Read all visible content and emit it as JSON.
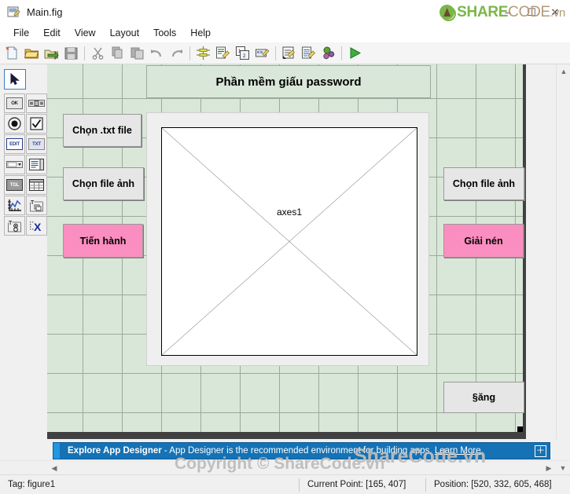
{
  "window": {
    "title": "Main.fig",
    "icon": "figure-file-icon",
    "controls": [
      {
        "name": "minimize-button",
        "glyph": "–"
      },
      {
        "name": "maximize-button",
        "glyph": "☐"
      },
      {
        "name": "close-button",
        "glyph": "✕"
      }
    ]
  },
  "brand": {
    "share": "SHARE",
    "code": "CODE",
    "vn": ".vn"
  },
  "menu": {
    "items": [
      "File",
      "Edit",
      "View",
      "Layout",
      "Tools",
      "Help"
    ]
  },
  "toolbar": {
    "groups": [
      [
        {
          "name": "new-figure-icon",
          "title": "New"
        },
        {
          "name": "open-folder-icon",
          "title": "Open"
        },
        {
          "name": "save-as-icon",
          "title": "Save As"
        },
        {
          "name": "save-icon",
          "title": "Save"
        }
      ],
      [
        {
          "name": "cut-icon",
          "title": "Cut"
        },
        {
          "name": "copy-icon",
          "title": "Copy"
        },
        {
          "name": "paste-icon",
          "title": "Paste"
        },
        {
          "name": "undo-icon",
          "title": "Undo"
        },
        {
          "name": "redo-icon",
          "title": "Redo"
        }
      ],
      [
        {
          "name": "align-objects-icon",
          "title": "Align Objects"
        },
        {
          "name": "menu-editor-icon",
          "title": "Menu Editor"
        },
        {
          "name": "tab-order-editor-icon",
          "title": "Tab Order Editor"
        },
        {
          "name": "toolbar-editor-icon",
          "title": "Toolbar Editor"
        }
      ],
      [
        {
          "name": "m-file-editor-icon",
          "title": "M-file Editor"
        },
        {
          "name": "property-inspector-icon",
          "title": "Property Inspector"
        },
        {
          "name": "object-browser-icon",
          "title": "Object Browser"
        }
      ],
      [
        {
          "name": "run-figure-icon",
          "title": "Run"
        }
      ]
    ]
  },
  "palette": {
    "pointer": {
      "name": "select-pointer-tool",
      "label": ""
    },
    "components": [
      {
        "name": "push-button-tool",
        "label": "OK"
      },
      {
        "name": "slider-tool",
        "label": ""
      },
      {
        "name": "radio-button-tool",
        "label": ""
      },
      {
        "name": "check-box-tool",
        "label": ""
      },
      {
        "name": "edit-text-tool",
        "label": "EDIT"
      },
      {
        "name": "static-text-tool",
        "label": "TXT"
      },
      {
        "name": "pop-up-menu-tool",
        "label": ""
      },
      {
        "name": "list-box-tool",
        "label": ""
      },
      {
        "name": "toggle-button-tool",
        "label": "TGL"
      },
      {
        "name": "table-tool",
        "label": ""
      },
      {
        "name": "axes-tool",
        "label": ""
      },
      {
        "name": "panel-tool",
        "label": "T"
      },
      {
        "name": "button-group-tool",
        "label": "T"
      },
      {
        "name": "activex-control-tool",
        "label": "X"
      }
    ]
  },
  "figure": {
    "title_label": "Phần mềm giấu password",
    "axes": {
      "tag": "axes1"
    },
    "buttons": [
      {
        "name": "choose-txt-file-button",
        "label": "Chọn .txt file",
        "style": "normal"
      },
      {
        "name": "choose-image-file-left-button",
        "label": "Chọn file ảnh",
        "style": "normal"
      },
      {
        "name": "proceed-button",
        "label": "Tiến hành",
        "style": "pink"
      },
      {
        "name": "choose-image-file-right-button",
        "label": "Chọn file ảnh",
        "style": "normal"
      },
      {
        "name": "decompress-button",
        "label": "Giải nén",
        "style": "pink"
      },
      {
        "name": "dang-button",
        "label": "§ăng",
        "style": "normal"
      }
    ]
  },
  "banner": {
    "bold": "Explore App Designer",
    "text": " - App Designer is the recommended environment for building apps. ",
    "link": "Learn More",
    "close": "＋"
  },
  "status": {
    "tag": "Tag: figure1",
    "current_point": "Current Point:  [165, 407]",
    "position": "Position: [520, 332, 605, 468]"
  },
  "watermarks": {
    "copyright": "Copyright © ShareCode.vn",
    "brand": "ShareCode.vn"
  },
  "colors": {
    "figure_bg": "#d9e7d9",
    "grid_line": "#9aaa9a",
    "pink_button": "#fb8ec0",
    "banner_blue": "#1572b5",
    "canvas_dark": "#414141"
  }
}
